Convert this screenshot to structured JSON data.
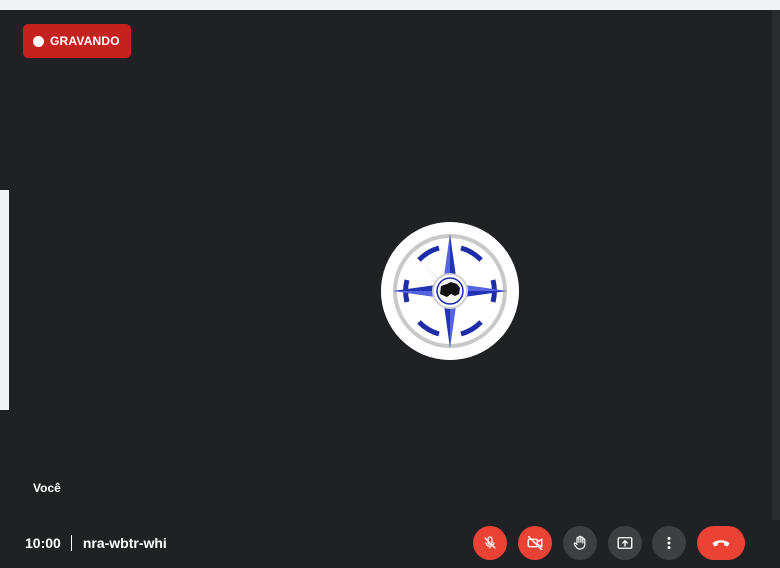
{
  "recording": {
    "label": "GRAVANDO",
    "color": "#c5221f"
  },
  "participant": {
    "self_label": "Você",
    "avatar_icon": "compass-rose-logo-icon"
  },
  "meeting": {
    "time": "10:00",
    "code": "nra-wbtr-whi"
  },
  "controls": [
    {
      "name": "microphone",
      "icon": "mic-off-icon",
      "state": "off",
      "color": "#ea4335"
    },
    {
      "name": "camera",
      "icon": "videocam-off-icon",
      "state": "off",
      "color": "#ea4335"
    },
    {
      "name": "raise-hand",
      "icon": "hand-icon",
      "color": "#3c4043"
    },
    {
      "name": "present-screen",
      "icon": "present-screen-icon",
      "color": "#3c4043"
    },
    {
      "name": "more-options",
      "icon": "more-vert-icon",
      "color": "#3c4043"
    },
    {
      "name": "leave-call",
      "icon": "call-end-icon",
      "color": "#ea4335"
    }
  ]
}
